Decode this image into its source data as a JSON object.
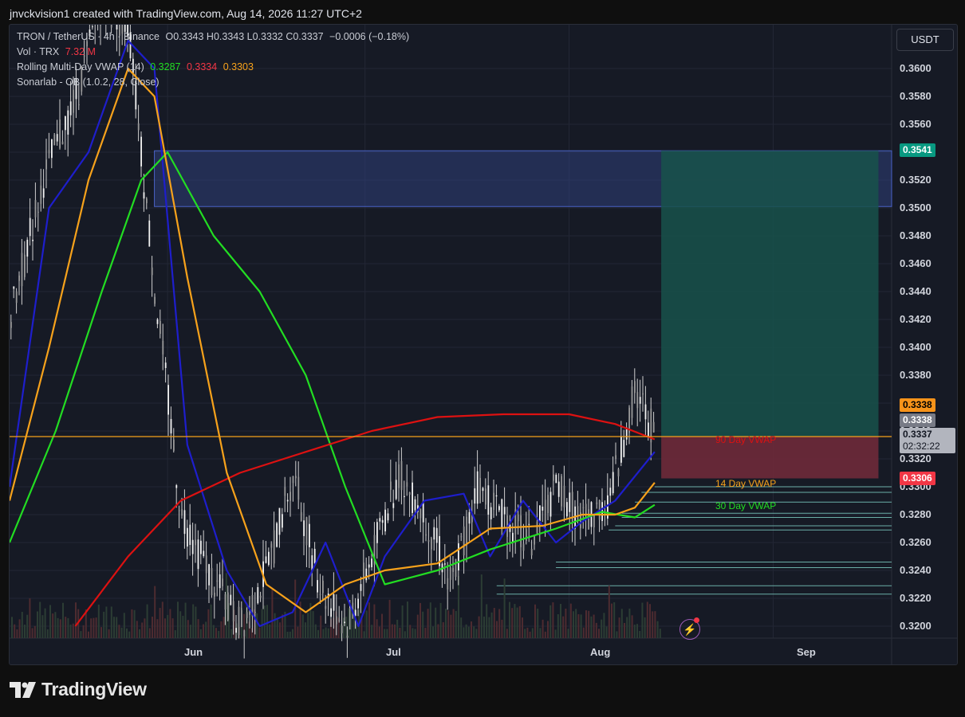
{
  "header": {
    "text": "jnvckvision1 created with TradingView.com, Aug 14, 2026 11:27 UTC+2"
  },
  "legend": {
    "symbol": "TRON / TetherUS · 4h · Binance",
    "ohlc": "O0.3343  H0.3343  L0.3332  C0.3337",
    "change": "−0.0006 (−0.18%)",
    "vol_label": "Vol · TRX",
    "vol_value": "7.32 M",
    "vwap_label": "Rolling Multi-Day VWAP (14)",
    "vwap_v1": "0.3287",
    "vwap_v2": "0.3334",
    "vwap_v3": "0.3303",
    "ob_label": "Sonarlab - OB (1.0.2, 28, Close)"
  },
  "price_axis": {
    "unit": "USDT",
    "ticks": [
      "0.3600",
      "0.3580",
      "0.3560",
      "0.3540",
      "0.3520",
      "0.3500",
      "0.3480",
      "0.3460",
      "0.3440",
      "0.3420",
      "0.3400",
      "0.3380",
      "0.3360",
      "0.3340",
      "0.3320",
      "0.3300",
      "0.3280",
      "0.3260",
      "0.3240",
      "0.3220",
      "0.3200"
    ],
    "labels": {
      "top_zone": "0.3541",
      "orange": "0.3338",
      "last_close": "0.3338",
      "current": "0.3337",
      "countdown": "02:32:22",
      "red": "0.3306"
    }
  },
  "time_axis": {
    "ticks": [
      "Jun",
      "Jul",
      "Aug",
      "Sep"
    ]
  },
  "vwap_labels": {
    "d90": "90 Day VWAP",
    "d14": "14 Day VWAP",
    "d30": "30 Day VWAP"
  },
  "brand": {
    "name": "TradingView"
  },
  "colors": {
    "background": "#161a25",
    "vwap_14": "#1e1ecc",
    "vwap_30": "#22dd22",
    "vwap_90": "#dd1111",
    "vwap_orange": "#f7a21b",
    "ob_zone": "#2f3f7a",
    "target_zone": "#17524b",
    "stop_zone": "#6e2a3a",
    "candles": "#d8d8d8"
  },
  "chart_data": {
    "type": "line",
    "title": "",
    "xlabel": "",
    "ylabel": "",
    "ylim": [
      0.32,
      0.36
    ],
    "x_ticks": [
      "Jun",
      "Jul",
      "Aug",
      "Sep"
    ],
    "x_range": [
      "2026-05-08",
      "2026-09-19"
    ],
    "price_series": {
      "name": "",
      "x": [
        "2026-05-08",
        "2026-05-13",
        "2026-05-18",
        "2026-05-22",
        "2026-05-26",
        "2026-05-30",
        "2026-06-03",
        "2026-06-07",
        "2026-06-12",
        "2026-06-16",
        "2026-06-20",
        "2026-06-24",
        "2026-06-28",
        "2026-07-02",
        "2026-07-06",
        "2026-07-10",
        "2026-07-14",
        "2026-07-18",
        "2026-07-22",
        "2026-07-26",
        "2026-07-30",
        "2026-08-03",
        "2026-08-07",
        "2026-08-11",
        "2026-08-14"
      ],
      "values": [
        0.342,
        0.352,
        0.358,
        0.365,
        0.363,
        0.344,
        0.328,
        0.324,
        0.32,
        0.324,
        0.331,
        0.323,
        0.32,
        0.325,
        0.331,
        0.328,
        0.323,
        0.33,
        0.328,
        0.326,
        0.33,
        0.3275,
        0.329,
        0.337,
        0.3337
      ]
    },
    "series": [
      {
        "name": "",
        "color": "#1e1ecc",
        "x": [
          "2026-05-08",
          "2026-05-14",
          "2026-05-20",
          "2026-05-26",
          "2026-05-30",
          "2026-06-04",
          "2026-06-10",
          "2026-06-15",
          "2026-06-20",
          "2026-06-25",
          "2026-06-30",
          "2026-07-04",
          "2026-07-10",
          "2026-07-16",
          "2026-07-20",
          "2026-07-25",
          "2026-07-30",
          "2026-08-03",
          "2026-08-08",
          "2026-08-14"
        ],
        "values": [
          0.33,
          0.35,
          0.354,
          0.362,
          0.36,
          0.333,
          0.324,
          0.32,
          0.321,
          0.326,
          0.32,
          0.325,
          0.329,
          0.3295,
          0.325,
          0.329,
          0.326,
          0.3275,
          0.329,
          0.3325
        ]
      },
      {
        "name": "30 Day VWAP",
        "color": "#22dd22",
        "x": [
          "2026-05-08",
          "2026-05-15",
          "2026-05-22",
          "2026-05-28",
          "2026-06-01",
          "2026-06-08",
          "2026-06-15",
          "2026-06-22",
          "2026-06-28",
          "2026-07-04",
          "2026-07-12",
          "2026-07-20",
          "2026-07-30",
          "2026-08-06",
          "2026-08-11",
          "2026-08-14"
        ],
        "values": [
          0.326,
          0.334,
          0.344,
          0.352,
          0.354,
          0.348,
          0.344,
          0.338,
          0.33,
          0.323,
          0.324,
          0.3255,
          0.327,
          0.3282,
          0.3278,
          0.3287
        ]
      },
      {
        "name": "90 Day VWAP",
        "color": "#dd1111",
        "x": [
          "2026-05-18",
          "2026-05-26",
          "2026-06-03",
          "2026-06-12",
          "2026-06-22",
          "2026-07-02",
          "2026-07-12",
          "2026-07-22",
          "2026-08-01",
          "2026-08-08",
          "2026-08-14"
        ],
        "values": [
          0.32,
          0.325,
          0.329,
          0.331,
          0.3325,
          0.334,
          0.335,
          0.3352,
          0.3352,
          0.3345,
          0.3334
        ]
      },
      {
        "name": "14 Day VWAP",
        "color": "#f7a21b",
        "x": [
          "2026-05-08",
          "2026-05-14",
          "2026-05-20",
          "2026-05-26",
          "2026-05-30",
          "2026-06-04",
          "2026-06-10",
          "2026-06-16",
          "2026-06-22",
          "2026-06-28",
          "2026-07-04",
          "2026-07-12",
          "2026-07-20",
          "2026-07-28",
          "2026-08-03",
          "2026-08-08",
          "2026-08-11",
          "2026-08-14"
        ],
        "values": [
          0.329,
          0.34,
          0.352,
          0.36,
          0.358,
          0.345,
          0.331,
          0.323,
          0.321,
          0.323,
          0.324,
          0.3245,
          0.327,
          0.3272,
          0.328,
          0.328,
          0.3285,
          0.3303
        ]
      }
    ],
    "zones": [
      {
        "kind": "order-block",
        "from": "2026-05-30",
        "to": "2026-09-30",
        "low": 0.3501,
        "high": 0.3541
      },
      {
        "kind": "target",
        "from": "2026-08-15",
        "to": "2026-09-17",
        "low": 0.3336,
        "high": 0.3541
      },
      {
        "kind": "stop",
        "from": "2026-08-15",
        "to": "2026-09-17",
        "low": 0.3306,
        "high": 0.3336
      }
    ],
    "support_levels": [
      {
        "from": "2026-08-14",
        "value": 0.33
      },
      {
        "from": "2026-08-12",
        "value": 0.3296
      },
      {
        "from": "2026-08-11",
        "value": 0.3289
      },
      {
        "from": "2026-08-09",
        "value": 0.3281
      },
      {
        "from": "2026-08-09",
        "value": 0.3278
      },
      {
        "from": "2026-08-08",
        "value": 0.3272
      },
      {
        "from": "2026-08-07",
        "value": 0.3269
      },
      {
        "from": "2026-07-30",
        "value": 0.3246
      },
      {
        "from": "2026-07-30",
        "value": 0.3242
      },
      {
        "from": "2026-07-21",
        "value": 0.3229
      },
      {
        "from": "2026-07-21",
        "value": 0.3223
      }
    ],
    "horizontal_line": {
      "value": 0.3336,
      "color": "#f7a21b"
    },
    "grid": true
  }
}
